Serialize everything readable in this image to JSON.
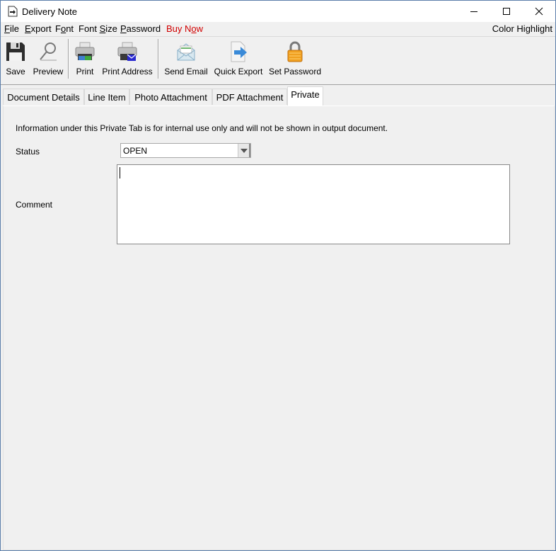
{
  "window": {
    "title": "Delivery Note",
    "icon": "document-arrow-icon",
    "controls": [
      "minimize",
      "maximize",
      "close"
    ]
  },
  "menu": {
    "items": [
      {
        "label": "File",
        "mnemonic": "F"
      },
      {
        "label": "Export",
        "mnemonic": "E"
      },
      {
        "label": "Font",
        "mnemonic": "o"
      },
      {
        "label": "Font Size",
        "mnemonic": "S"
      },
      {
        "label": "Password",
        "mnemonic": "P"
      },
      {
        "label": "Buy Now",
        "mnemonic": "o",
        "color": "#d10000"
      }
    ],
    "right_item": "Color Highlight"
  },
  "toolbar": {
    "buttons": [
      {
        "label": "Save",
        "icon": "floppy-disk-icon"
      },
      {
        "label": "Preview",
        "icon": "magnifier-icon"
      },
      {
        "label": "Print",
        "icon": "printer-icon"
      },
      {
        "label": "Print Address",
        "icon": "printer-envelope-icon"
      },
      {
        "label": "Send Email",
        "icon": "envelope-open-icon"
      },
      {
        "label": "Quick Export",
        "icon": "document-export-icon"
      },
      {
        "label": "Set Password",
        "icon": "padlock-icon"
      }
    ]
  },
  "tabs": {
    "items": [
      "Document Details",
      "Line Item",
      "Photo Attachment",
      "PDF Attachment",
      "Private"
    ],
    "active": "Private"
  },
  "private_tab": {
    "info": "Information under this Private Tab is for internal use only and will not be shown in output document.",
    "status_label": "Status",
    "status_value": "OPEN",
    "comment_label": "Comment",
    "comment_value": ""
  },
  "colors": {
    "accent_border": "#5b7fab",
    "buy_now": "#d10000",
    "background": "#f0f0f0"
  }
}
